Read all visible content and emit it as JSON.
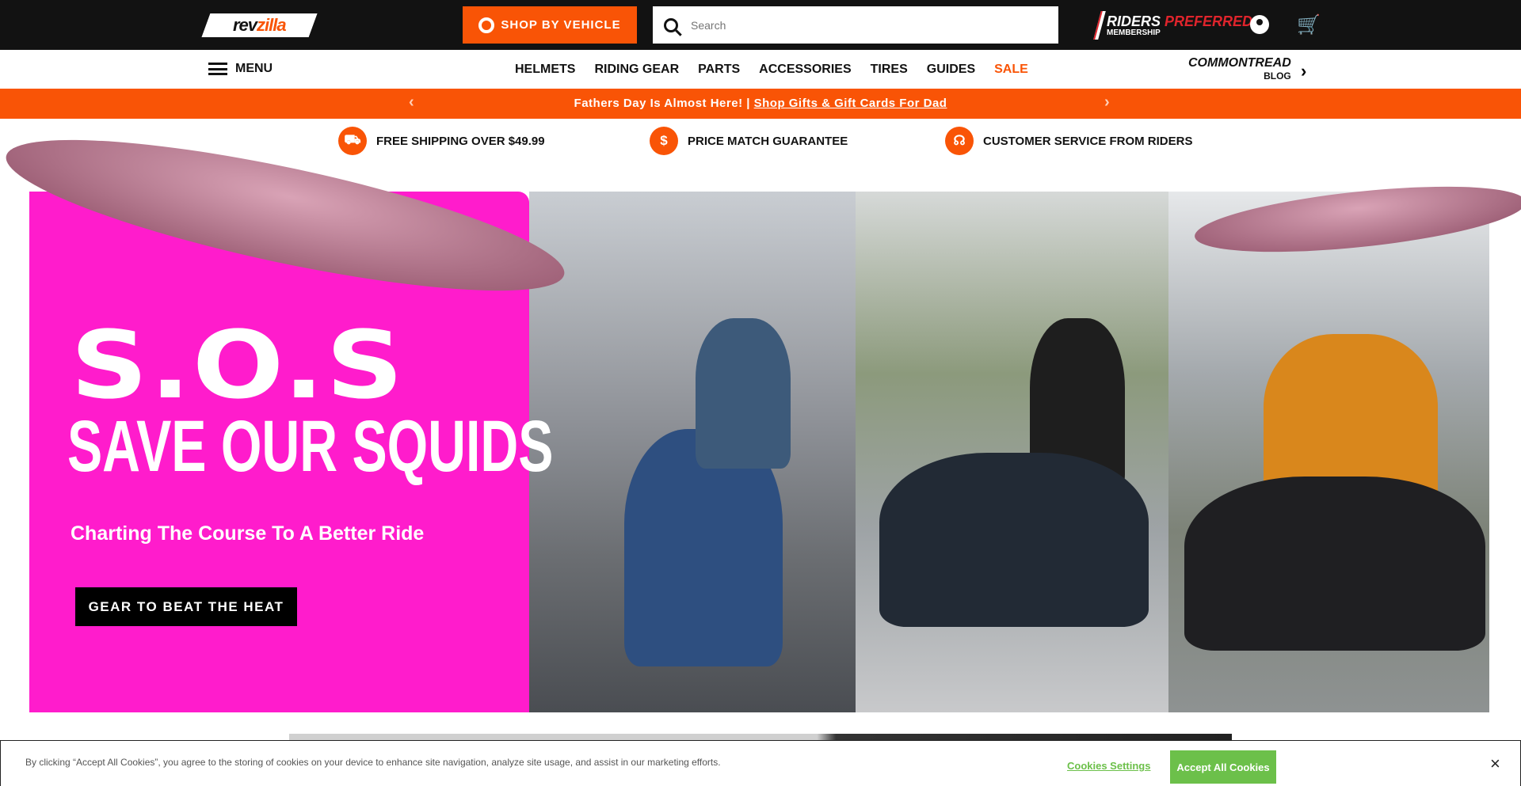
{
  "header": {
    "logo": "revzilla",
    "shop_by_vehicle": "SHOP BY VEHICLE",
    "search_placeholder": "Search",
    "riders_preferred": {
      "riders": "RIDERS",
      "preferred": "PREFERRED",
      "membership": "MEMBERSHIP"
    },
    "user_icon": "user-icon",
    "cart_icon": "cart-icon"
  },
  "nav": {
    "menu": "MENU",
    "items": [
      {
        "label": "HELMETS"
      },
      {
        "label": "RIDING GEAR"
      },
      {
        "label": "PARTS"
      },
      {
        "label": "ACCESSORIES"
      },
      {
        "label": "TIRES"
      },
      {
        "label": "GUIDES"
      },
      {
        "label": "SALE"
      }
    ],
    "commontread": "COMMONTREAD",
    "blog": "BLOG"
  },
  "promo": {
    "text": "Fathers Day Is Almost Here! |",
    "link": "Shop Gifts & Gift Cards For Dad"
  },
  "value_props": [
    {
      "label": "FREE SHIPPING OVER $49.99",
      "icon": "truck-icon"
    },
    {
      "label": "PRICE MATCH GUARANTEE",
      "icon": "dollar-icon"
    },
    {
      "label": "CUSTOMER SERVICE FROM RIDERS",
      "icon": "headset-icon"
    }
  ],
  "hero": {
    "title": "S.O.S",
    "headline": "SAVE OUR SQUIDS",
    "subtitle": "Charting The Course To A Better Ride",
    "cta": "GEAR TO BEAT THE HEAT"
  },
  "cookie": {
    "text": "By clicking “Accept All Cookies”, you agree to the storing of cookies on your device to enhance site navigation, analyze site usage, and assist in our marketing efforts.",
    "settings": "Cookies Settings",
    "accept": "Accept All Cookies",
    "close": "×"
  },
  "colors": {
    "brand": "#f95406",
    "hero_pink": "#ff1ccc",
    "accept_green": "#6cc04a"
  }
}
